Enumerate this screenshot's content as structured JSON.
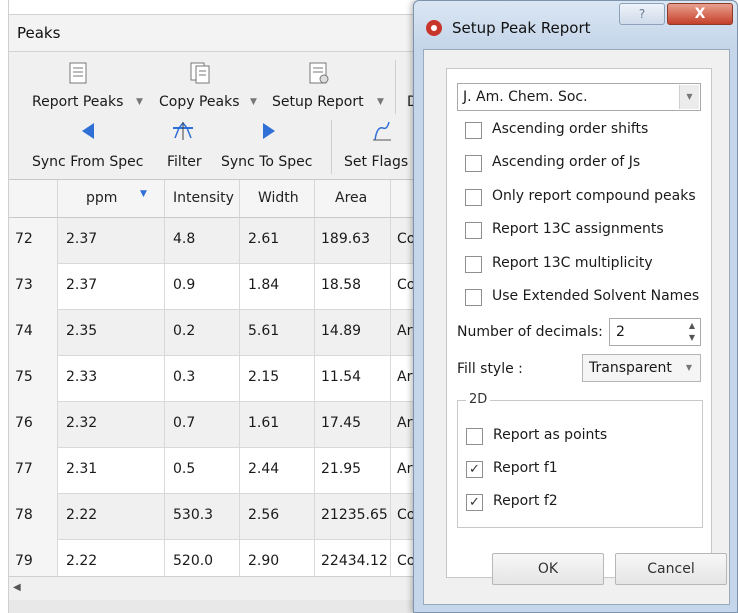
{
  "peaks_panel": {
    "title": "Peaks",
    "toolbar": {
      "report_peaks": "Report Peaks",
      "copy_peaks": "Copy Peaks",
      "setup_report": "Setup Report",
      "sync_from_spec": "Sync From Spec",
      "filter": "Filter",
      "sync_to_spec": "Sync To Spec",
      "set_flags": "Set Flags",
      "overflow_char": "D"
    },
    "table": {
      "columns": [
        "ppm",
        "Intensity",
        "Width",
        "Area",
        ""
      ],
      "rows": [
        {
          "n": "72",
          "ppm": "2.37",
          "intensity": "4.8",
          "width": "2.61",
          "area": "189.63",
          "type": "Co"
        },
        {
          "n": "73",
          "ppm": "2.37",
          "intensity": "0.9",
          "width": "1.84",
          "area": "18.58",
          "type": "Co"
        },
        {
          "n": "74",
          "ppm": "2.35",
          "intensity": "0.2",
          "width": "5.61",
          "area": "14.89",
          "type": "Art"
        },
        {
          "n": "75",
          "ppm": "2.33",
          "intensity": "0.3",
          "width": "2.15",
          "area": "11.54",
          "type": "Art"
        },
        {
          "n": "76",
          "ppm": "2.32",
          "intensity": "0.7",
          "width": "1.61",
          "area": "17.45",
          "type": "Art"
        },
        {
          "n": "77",
          "ppm": "2.31",
          "intensity": "0.5",
          "width": "2.44",
          "area": "21.95",
          "type": "Art"
        },
        {
          "n": "78",
          "ppm": "2.22",
          "intensity": "530.3",
          "width": "2.56",
          "area": "21235.65",
          "type": "Co"
        },
        {
          "n": "79",
          "ppm": "2.22",
          "intensity": "520.0",
          "width": "2.90",
          "area": "22434.12",
          "type": "Co"
        }
      ]
    }
  },
  "dialog": {
    "title": "Setup Peak Report",
    "help_glyph": "?",
    "close_glyph": "X",
    "journal_format": "J. Am. Chem. Soc.",
    "options": [
      {
        "label": "Ascending order shifts",
        "checked": false
      },
      {
        "label": "Ascending order of Js",
        "checked": false
      },
      {
        "label": "Only report compound peaks",
        "checked": false
      },
      {
        "label": "Report 13C assignments",
        "checked": false
      },
      {
        "label": "Report 13C multiplicity",
        "checked": false
      },
      {
        "label": "Use Extended Solvent Names",
        "checked": false
      }
    ],
    "decimals_label": "Number of decimals:",
    "decimals_value": "2",
    "fill_style_label": "Fill style :",
    "fill_style_value": "Transparent",
    "group_2d": {
      "title": "2D",
      "options": [
        {
          "label": "Report as points",
          "checked": false
        },
        {
          "label": "Report f1",
          "checked": true
        },
        {
          "label": "Report f2",
          "checked": true
        }
      ]
    },
    "ok_label": "OK",
    "cancel_label": "Cancel"
  },
  "colors": {
    "accent_blue": "#2f6fd6",
    "dialog_frame": "#c5d6ea",
    "close_red": "#c4402a",
    "app_icon_red": "#c8352a"
  }
}
